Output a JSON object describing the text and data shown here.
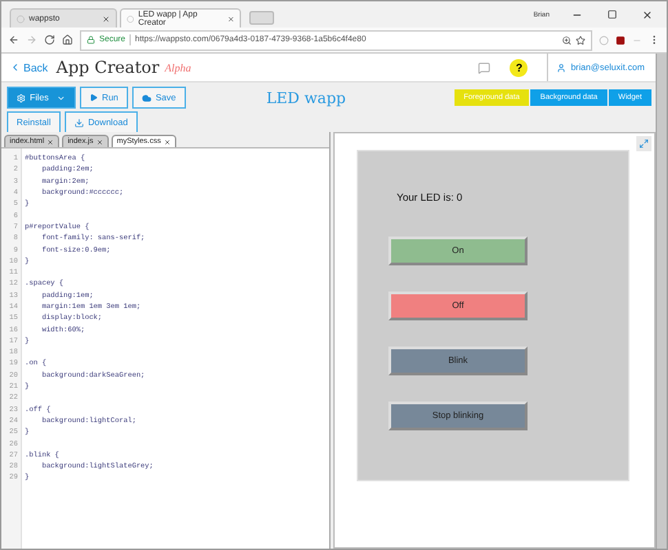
{
  "browser": {
    "tabs": [
      {
        "title": "wappsto",
        "selected": false
      },
      {
        "title": "LED wapp | App Creator",
        "selected": true
      }
    ],
    "profile": "Brian",
    "secure_label": "Secure",
    "url": "https://wappsto.com/0679a4d3-0187-4739-9368-1a5b6c4f4e80"
  },
  "header": {
    "back": "Back",
    "title": "App Creator",
    "badge": "Alpha",
    "user": "brian@seluxit.com",
    "help": "?"
  },
  "toolbar": {
    "buttons": [
      {
        "label": "Files",
        "kind": "dropdown"
      },
      {
        "label": "Run",
        "kind": "run"
      },
      {
        "label": "Save",
        "kind": "save"
      },
      {
        "label": "Reinstall",
        "kind": "plain"
      },
      {
        "label": "Download",
        "kind": "download"
      }
    ],
    "title": "LED wapp",
    "data_tabs": [
      {
        "label": "Foreground data",
        "selected": true
      },
      {
        "label": "Background data",
        "selected": false
      },
      {
        "label": "Widget",
        "selected": false
      }
    ]
  },
  "file_tabs": [
    {
      "name": "index.html",
      "selected": false
    },
    {
      "name": "index.js",
      "selected": false
    },
    {
      "name": "myStyles.css",
      "selected": true
    }
  ],
  "code_lines": [
    {
      "num": "1",
      "text": "#buttonsArea {"
    },
    {
      "num": "2",
      "text": "    padding:2em;"
    },
    {
      "num": "3",
      "text": "    margin:2em;"
    },
    {
      "num": "4",
      "text": "    background:#cccccc;"
    },
    {
      "num": "5",
      "text": "}"
    },
    {
      "num": "6"
    },
    {
      "num": "7",
      "text": "p#reportValue {"
    },
    {
      "num": "8",
      "text": "    font-family: sans-serif;"
    },
    {
      "num": "9",
      "text": "    font-size:0.9em;"
    },
    {
      "num": "10",
      "text": "}"
    },
    {
      "num": "11"
    },
    {
      "num": "12",
      "text": ".spacey {"
    },
    {
      "num": "13",
      "text": "    padding:1em;"
    },
    {
      "num": "14",
      "text": "    margin:1em 1em 3em 1em;"
    },
    {
      "num": "15",
      "text": "    display:block;"
    },
    {
      "num": "16",
      "text": "    width:60%;"
    },
    {
      "num": "17",
      "text": "}"
    },
    {
      "num": "18"
    },
    {
      "num": "19",
      "text": ".on {"
    },
    {
      "num": "20",
      "text": "    background:darkSeaGreen;"
    },
    {
      "num": "21",
      "text": "}"
    },
    {
      "num": "22"
    },
    {
      "num": "23",
      "text": ".off {"
    },
    {
      "num": "24",
      "text": "    background:lightCoral;"
    },
    {
      "num": "25",
      "text": "}"
    },
    {
      "num": "26"
    },
    {
      "num": "27",
      "text": ".blink {"
    },
    {
      "num": "28",
      "text": "    background:lightSlateGrey;"
    },
    {
      "num": "29",
      "text": "}"
    }
  ],
  "preview": {
    "report": "Your LED is: 0",
    "buttons": [
      {
        "label": "On",
        "color": "#8fbc8f"
      },
      {
        "label": "Off",
        "color": "#f08080"
      },
      {
        "label": "Blink",
        "color": "#778899"
      },
      {
        "label": "Stop blinking",
        "color": "#778899"
      }
    ]
  }
}
